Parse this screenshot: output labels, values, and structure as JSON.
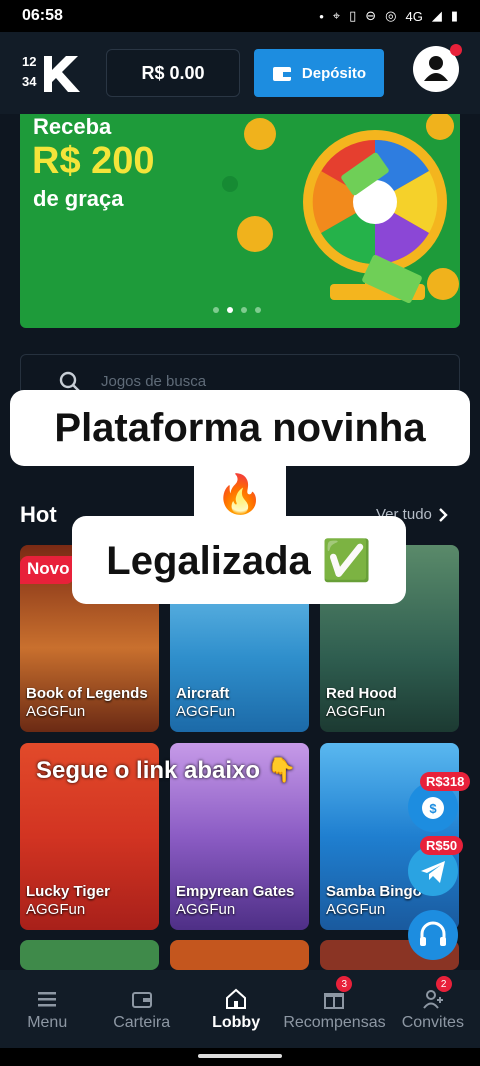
{
  "status_bar": {
    "time": "06:58",
    "network": "4G"
  },
  "header": {
    "logo_text": "1234K",
    "balance": "R$ 0.00",
    "deposit_label": "Depósito"
  },
  "banner": {
    "line1": "Receba",
    "line2": "R$ 200",
    "line3": "de graça",
    "slides": 4,
    "active_slide": 2
  },
  "search": {
    "placeholder": "Jogos de busca"
  },
  "overlay": {
    "caption1": "Plataforma novinha",
    "caption1_emoji": "🔥",
    "caption2": "Legalizada ✅",
    "caption3": "Segue o link abaixo",
    "caption3_emoji": "👇"
  },
  "hot": {
    "title": "Hot",
    "see_all": "Ver tudo",
    "new_badge": "Novo",
    "games": [
      {
        "title": "Book of Legends",
        "provider": "AGGFun",
        "color": "#b8562a"
      },
      {
        "title": "Aircraft",
        "provider": "AGGFun",
        "color": "#2f8fcc"
      },
      {
        "title": "Red Hood",
        "provider": "AGGFun",
        "color": "#2f5e50"
      },
      {
        "title": "Lucky Tiger",
        "provider": "AGGFun",
        "color": "#d23422"
      },
      {
        "title": "Empyrean Gates",
        "provider": "AGGFun",
        "color": "#8b5cc4"
      },
      {
        "title": "Samba Bingo",
        "provider": "AGGFun",
        "color": "#1f7fd0"
      }
    ]
  },
  "floating": {
    "reward1": "R$318",
    "reward2": "R$50"
  },
  "nav": {
    "items": [
      {
        "label": "Menu",
        "badge": ""
      },
      {
        "label": "Carteira",
        "badge": ""
      },
      {
        "label": "Lobby",
        "badge": ""
      },
      {
        "label": "Recompensas",
        "badge": "3"
      },
      {
        "label": "Convites",
        "badge": "2"
      }
    ],
    "active": "Lobby"
  },
  "colors": {
    "bg": "#0e1620",
    "accent": "#1d8de0",
    "banner": "#1e9b3a",
    "highlight": "#f4e43a",
    "badge": "#e8213a"
  }
}
